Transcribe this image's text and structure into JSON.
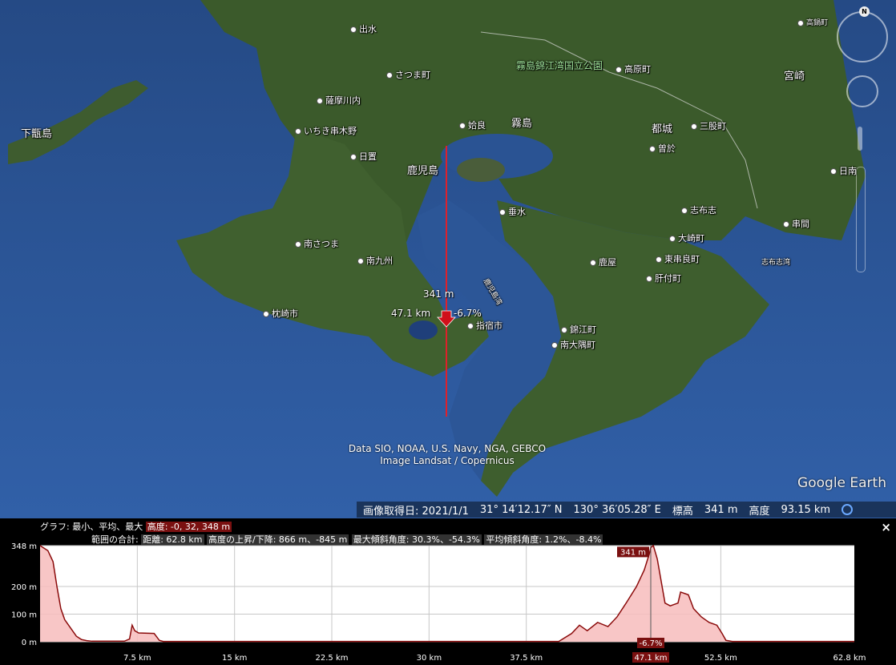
{
  "map": {
    "places": [
      {
        "name": "出水",
        "type": "dot"
      },
      {
        "name": "さつま町",
        "type": "dot"
      },
      {
        "name": "霧島錦江湾国立公園",
        "type": "green"
      },
      {
        "name": "高原町",
        "type": "dot"
      },
      {
        "name": "宮崎",
        "type": "big"
      },
      {
        "name": "高鍋町",
        "type": "dot"
      },
      {
        "name": "薩摩川内",
        "type": "dot"
      },
      {
        "name": "下甑島",
        "type": "big"
      },
      {
        "name": "いちき串木野",
        "type": "dot"
      },
      {
        "name": "姶良",
        "type": "dot"
      },
      {
        "name": "霧島",
        "type": "big"
      },
      {
        "name": "都城",
        "type": "big"
      },
      {
        "name": "三股町",
        "type": "dot"
      },
      {
        "name": "曽於",
        "type": "dot"
      },
      {
        "name": "日置",
        "type": "dot"
      },
      {
        "name": "鹿児島",
        "type": "big"
      },
      {
        "name": "日南",
        "type": "dot"
      },
      {
        "name": "垂水",
        "type": "dot"
      },
      {
        "name": "志布志",
        "type": "dot"
      },
      {
        "name": "串間",
        "type": "dot"
      },
      {
        "name": "南さつま",
        "type": "dot"
      },
      {
        "name": "大崎町",
        "type": "dot"
      },
      {
        "name": "志布志湾",
        "type": "small"
      },
      {
        "name": "南九州",
        "type": "dot"
      },
      {
        "name": "鹿屋",
        "type": "dot"
      },
      {
        "name": "東串良町",
        "type": "dot"
      },
      {
        "name": "肝付町",
        "type": "dot"
      },
      {
        "name": "鹿児島湾",
        "type": "small"
      },
      {
        "name": "枕崎市",
        "type": "dot"
      },
      {
        "name": "指宿市",
        "type": "dot"
      },
      {
        "name": "錦江町",
        "type": "dot"
      },
      {
        "name": "南大隅町",
        "type": "dot"
      }
    ],
    "marker": {
      "elevation": "341 m",
      "distance": "47.1 km",
      "slope": "-6.7%"
    },
    "attribution": [
      "Data SIO, NOAA, U.S. Navy, NGA, GEBCO",
      "Image Landsat / Copernicus"
    ],
    "logo": "Google Earth",
    "north_label": "N",
    "status": {
      "image_date": "画像取得日: 2021/1/1",
      "lat": "31° 14′12.17″ N",
      "lon": "130° 36′05.28″ E",
      "elev_label": "標高",
      "elev": "341 m",
      "alt_label": "高度",
      "alt": "93.15 km"
    },
    "colors": {
      "sea": "#1f3f7a",
      "land": "#3d5a2c",
      "path": "#e0202a"
    }
  },
  "panel": {
    "graph_label": "グラフ: 最小、平均、最大",
    "graph_value": "高度: -0, 32, 348 m",
    "total_label": "範囲の合計:",
    "distance": "距離: 62.8 km",
    "gain": "高度の上昇/下降: 866 m、-845 m",
    "max_slope": "最大傾斜角度: 30.3%、-54.3%",
    "avg_slope": "平均傾斜角度: 1.2%、-8.4%",
    "close": "×"
  },
  "chart_data": {
    "type": "area",
    "ylabels": [
      "348 m",
      "200 m",
      "100 m",
      "0 m"
    ],
    "xlabels": [
      "7.5 km",
      "15 km",
      "22.5 km",
      "30 km",
      "37.5 km",
      "47.1 km",
      "52.5 km",
      "62.8 km"
    ],
    "ylim": [
      0,
      348
    ],
    "xlim": [
      0,
      62.8
    ],
    "cursor": {
      "x_label": "47.1 km",
      "y_label": "341 m",
      "slope_label": "-6.7%",
      "x": 47.1,
      "y": 341
    },
    "points": [
      [
        0,
        348
      ],
      [
        0.6,
        330
      ],
      [
        1.0,
        290
      ],
      [
        1.3,
        200
      ],
      [
        1.6,
        120
      ],
      [
        1.9,
        80
      ],
      [
        2.2,
        60
      ],
      [
        2.5,
        40
      ],
      [
        2.8,
        20
      ],
      [
        3.2,
        8
      ],
      [
        3.6,
        4
      ],
      [
        4,
        2
      ],
      [
        6.5,
        2
      ],
      [
        6.9,
        10
      ],
      [
        7.1,
        60
      ],
      [
        7.3,
        40
      ],
      [
        7.6,
        32
      ],
      [
        8.8,
        30
      ],
      [
        9.2,
        5
      ],
      [
        9.5,
        1
      ],
      [
        40,
        1
      ],
      [
        41.0,
        30
      ],
      [
        41.6,
        60
      ],
      [
        42.2,
        40
      ],
      [
        43,
        70
      ],
      [
        43.8,
        55
      ],
      [
        44.5,
        90
      ],
      [
        45.2,
        140
      ],
      [
        46,
        200
      ],
      [
        46.6,
        260
      ],
      [
        47.0,
        320
      ],
      [
        47.1,
        341
      ],
      [
        47.3,
        348
      ],
      [
        47.6,
        300
      ],
      [
        47.9,
        220
      ],
      [
        48.2,
        140
      ],
      [
        48.6,
        130
      ],
      [
        49.2,
        140
      ],
      [
        49.4,
        180
      ],
      [
        50,
        170
      ],
      [
        50.4,
        120
      ],
      [
        51,
        90
      ],
      [
        51.6,
        70
      ],
      [
        52.2,
        60
      ],
      [
        52.6,
        30
      ],
      [
        52.9,
        5
      ],
      [
        53.4,
        1
      ],
      [
        62.8,
        1
      ]
    ],
    "colors": {
      "fill": "#f7bcbc",
      "line": "#8b0b0b",
      "grid": "#c7c7c7"
    }
  }
}
